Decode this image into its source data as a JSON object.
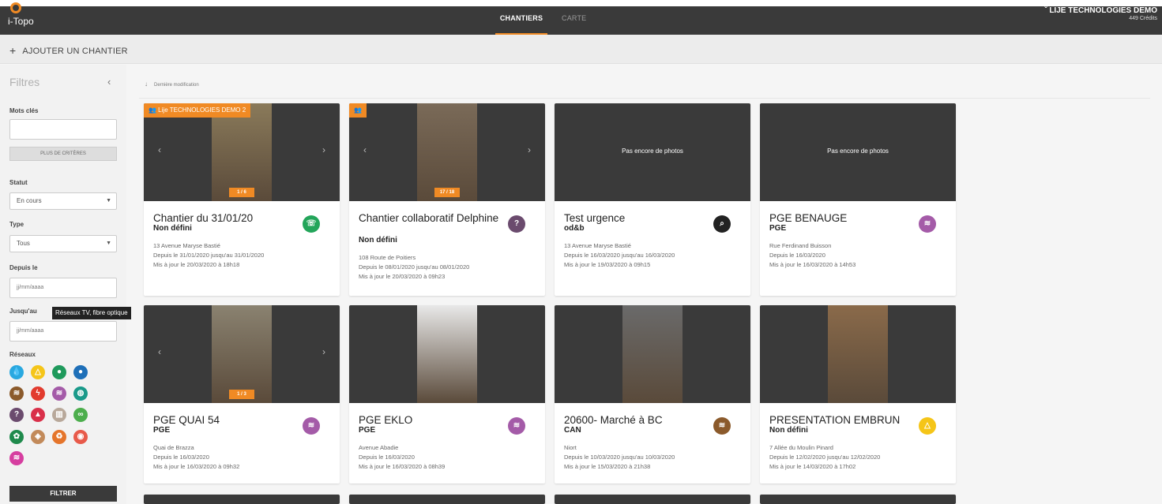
{
  "topbar": {
    "logo_text": "i-Topo",
    "tabs": [
      "CHANTIERS",
      "CARTE"
    ],
    "account_name": "LIJE TECHNOLOGIES DEMO",
    "account_credits": "449 Crédits",
    "account_chevron": "ˇ"
  },
  "addbar": {
    "label": "AJOUTER UN CHANTIER",
    "plus": "+"
  },
  "sidebar": {
    "title": "Filtres",
    "collapse": "‹",
    "keywords_label": "Mots clés",
    "keywords_value": "",
    "more_criteria": "PLUS DE CRITÈRES",
    "status_label": "Statut",
    "status_value": "En cours",
    "type_label": "Type",
    "type_value": "Tous",
    "since_label": "Depuis le",
    "since_placeholder": "jj/mm/aaaa",
    "until_label": "Jusqu'au",
    "until_placeholder": "jj/mm/aaaa",
    "networks_label": "Réseaux",
    "tooltip": "Réseaux TV, fibre optique",
    "filter_button": "FILTRER",
    "networks": [
      {
        "icon": "water-drop-icon",
        "color": "#29a8e0",
        "glyph": "💧"
      },
      {
        "icon": "gas-flame-icon",
        "color": "#f5c518",
        "glyph": "△"
      },
      {
        "icon": "green-network-icon",
        "color": "#1f9a5c",
        "glyph": "●"
      },
      {
        "icon": "blue-network-icon",
        "color": "#1e6fb8",
        "glyph": "●"
      },
      {
        "icon": "sewer-icon",
        "color": "#8b5a2b",
        "glyph": "≋"
      },
      {
        "icon": "electricity-icon",
        "color": "#e23b2e",
        "glyph": "ϟ"
      },
      {
        "icon": "heating-icon",
        "color": "#a45ba8",
        "glyph": "≋"
      },
      {
        "icon": "fiber-optic-icon",
        "color": "#1a9a8a",
        "glyph": "◍"
      },
      {
        "icon": "unknown-network-icon",
        "color": "#6b4b6e",
        "glyph": "?"
      },
      {
        "icon": "hazard-icon",
        "color": "#d9304a",
        "glyph": "▲"
      },
      {
        "icon": "column-icon",
        "color": "#b8a89a",
        "glyph": "▥"
      },
      {
        "icon": "link-icon",
        "color": "#4cae4c",
        "glyph": "∞"
      },
      {
        "icon": "tree-icon",
        "color": "#1f8a4c",
        "glyph": "✿"
      },
      {
        "icon": "vase-icon",
        "color": "#c28a5a",
        "glyph": "◈"
      },
      {
        "icon": "recycle-icon",
        "color": "#e5752b",
        "glyph": "♻"
      },
      {
        "icon": "hydrant-icon",
        "color": "#e85a4a",
        "glyph": "◉"
      },
      {
        "icon": "pink-network-icon",
        "color": "#d63ea0",
        "glyph": "≋"
      }
    ]
  },
  "sort": {
    "label": "Dernière modification",
    "arrow": "↓"
  },
  "cards": [
    {
      "title": "Chantier du 31/01/20",
      "subtitle": "Non défini",
      "address": "13 Avenue Maryse Bastié",
      "dates": "Depuis le 31/01/2020  jusqu'au 31/01/2020",
      "updated": "Mis à jour le 20/03/2020 à 18h18",
      "badge": "Lije TECHNOLOGIES DEMO 2",
      "counter": "1 / 6",
      "photo": "yes",
      "icon_name": "telecom-icon",
      "icon_color": "#23a55a",
      "icon_glyph": "☏"
    },
    {
      "title": "Chantier collaboratif Delphine",
      "subtitle": "Non défini",
      "address": "108 Route de Poitiers",
      "dates": "Depuis le 08/01/2020  jusqu'au 08/01/2020",
      "updated": "Mis à jour le 20/03/2020 à 09h23",
      "badge": "",
      "counter": "17 / 18",
      "photo": "yes",
      "icon_name": "unknown-network-icon",
      "icon_color": "#6b4b6e",
      "icon_glyph": "?"
    },
    {
      "title": "Test urgence",
      "subtitle": "od&b",
      "address": "13 Avenue Maryse Bastié",
      "dates": "Depuis le 16/03/2020  jusqu'au 16/03/2020",
      "updated": "Mis à jour le 19/03/2020 à 09h15",
      "badge": "",
      "counter": "",
      "photo": "none",
      "nophoto": "Pas encore de photos",
      "icon_name": "search-pin-icon",
      "icon_color": "#222222",
      "icon_glyph": "⌕"
    },
    {
      "title": "PGE BENAUGE",
      "subtitle": "PGE",
      "address": "Rue Ferdinand Buisson",
      "dates": "Depuis le 16/03/2020",
      "updated": "Mis à jour le 16/03/2020 à 14h53",
      "badge": "",
      "counter": "",
      "photo": "none",
      "nophoto": "Pas encore de photos",
      "icon_name": "heating-icon",
      "icon_color": "#a45ba8",
      "icon_glyph": "≋"
    },
    {
      "title": "PGE QUAI 54",
      "subtitle": "PGE",
      "address": "Quai de Brazza",
      "dates": "Depuis le 16/03/2020",
      "updated": "Mis à jour le 16/03/2020 à 09h32",
      "badge": "",
      "counter": "1 / 3",
      "photo": "yes",
      "icon_name": "heating-icon",
      "icon_color": "#a45ba8",
      "icon_glyph": "≋"
    },
    {
      "title": "PGE EKLO",
      "subtitle": "PGE",
      "address": "Avenue Abadie",
      "dates": "Depuis le 16/03/2020",
      "updated": "Mis à jour le 16/03/2020 à 08h39",
      "badge": "",
      "counter": "",
      "photo": "yes",
      "icon_name": "heating-icon",
      "icon_color": "#a45ba8",
      "icon_glyph": "≋"
    },
    {
      "title": "20600- Marché à BC",
      "subtitle": "CAN",
      "address": "Niort",
      "dates": "Depuis le 10/03/2020  jusqu'au 10/03/2020",
      "updated": "Mis à jour le 15/03/2020 à 21h38",
      "badge": "",
      "counter": "",
      "photo": "yes",
      "icon_name": "sewer-icon",
      "icon_color": "#8b5a2b",
      "icon_glyph": "≋"
    },
    {
      "title": "PRESENTATION EMBRUN",
      "subtitle": "Non défini",
      "address": "7 Allée du Moulin Pinard",
      "dates": "Depuis le 12/02/2020  jusqu'au 12/02/2020",
      "updated": "Mis à jour le 14/03/2020 à 17h02",
      "badge": "",
      "counter": "",
      "photo": "yes",
      "icon_name": "gas-flame-icon",
      "icon_color": "#f5c518",
      "icon_glyph": "△"
    }
  ],
  "colors": {
    "accent": "#f08a24",
    "topbar": "#3a3a3a"
  }
}
